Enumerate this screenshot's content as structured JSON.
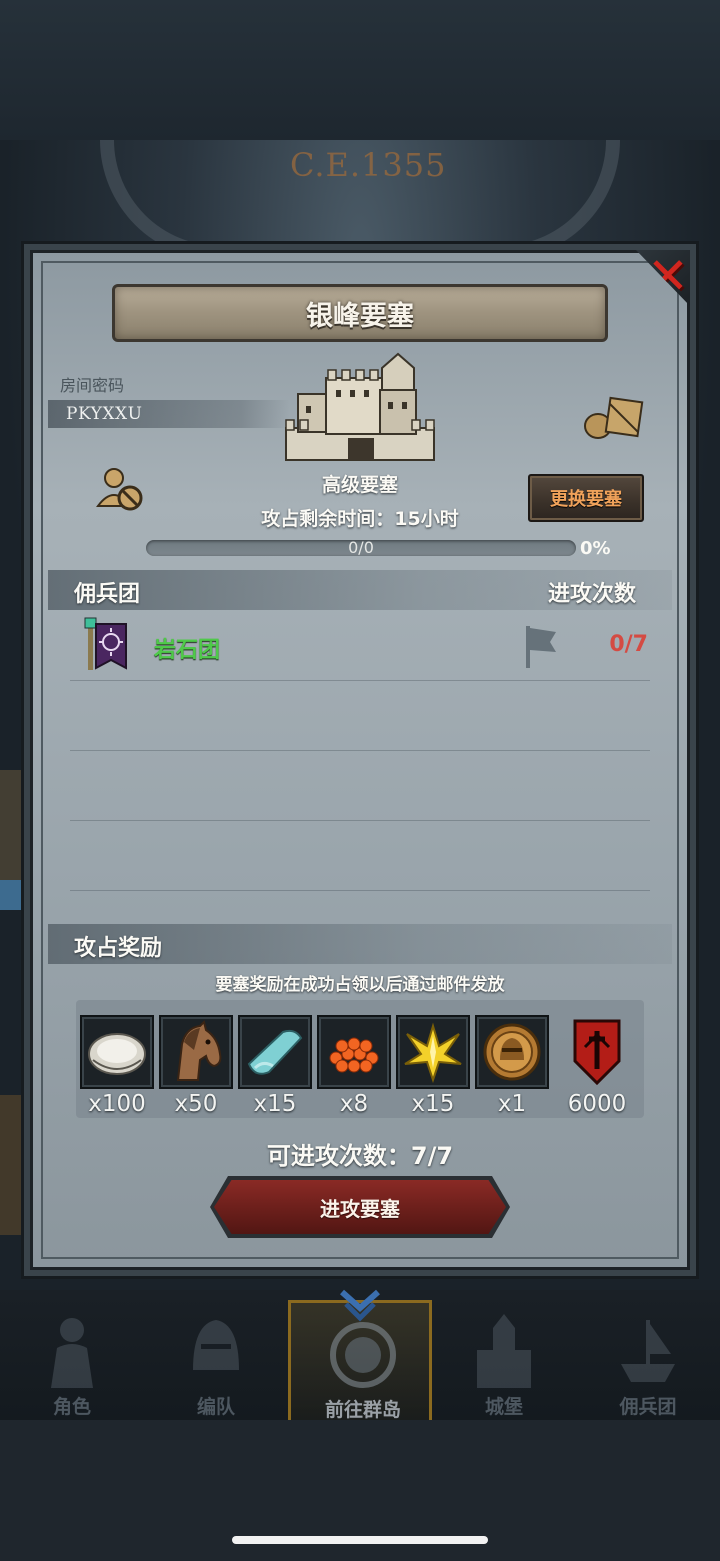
{
  "background": {
    "year": "C.E.1355"
  },
  "panel": {
    "title": "银峰要塞",
    "room": {
      "label": "房间密码",
      "code": "PKYXXU"
    },
    "fortress": {
      "type": "高级要塞",
      "change_button": "更换要塞",
      "time_remaining": "攻占剩余时间：15小时",
      "progress_text": "0/0",
      "progress_percent": "0%",
      "progress_value": 0
    },
    "mercenary_section": {
      "title": "佣兵团",
      "attacks_header": "进攻次数",
      "rows": [
        {
          "name": "岩石团",
          "attacks": "0/7"
        }
      ]
    },
    "rewards_section": {
      "title": "攻占奖励",
      "note": "要塞奖励在成功占领以后通过邮件发放",
      "items": [
        {
          "icon": "oyster-icon",
          "qty": "x100"
        },
        {
          "icon": "horse-icon",
          "qty": "x50"
        },
        {
          "icon": "cloth-icon",
          "qty": "x15"
        },
        {
          "icon": "caviar-icon",
          "qty": "x8"
        },
        {
          "icon": "gold-crystal-icon",
          "qty": "x15"
        },
        {
          "icon": "knight-medal-icon",
          "qty": "x1"
        },
        {
          "icon": "red-shield-icon",
          "qty": "6000"
        }
      ]
    },
    "attempts": "可进攻次数：7/7",
    "attack_button": "进攻要塞"
  },
  "nav": {
    "items": [
      {
        "label": "角色",
        "icon": "knight-icon"
      },
      {
        "label": "编队",
        "icon": "helmet-icon"
      },
      {
        "label": "前往群岛",
        "icon": "compass-icon",
        "active": true
      },
      {
        "label": "城堡",
        "icon": "castle-icon"
      },
      {
        "label": "佣兵团",
        "icon": "ship-icon"
      }
    ]
  },
  "colors": {
    "accent_green": "#4fc94a",
    "accent_red": "#d44b43",
    "close_red": "#d1261f",
    "button_orange": "#f0a25a"
  }
}
